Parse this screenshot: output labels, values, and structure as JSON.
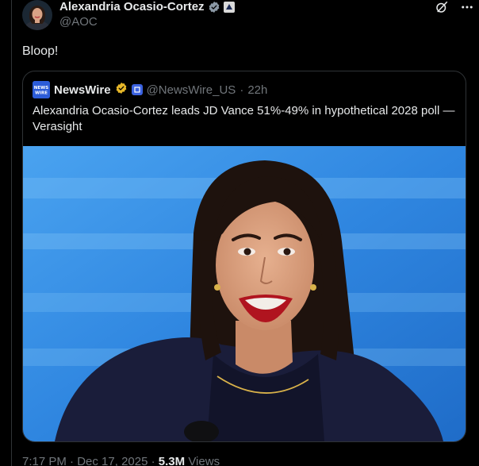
{
  "author": {
    "display_name": "Alexandria Ocasio-Cortez",
    "handle": "@AOC"
  },
  "post": {
    "text": "Bloop!"
  },
  "quoted": {
    "name": "NewsWire",
    "handle": "@NewsWire_US",
    "separator": "·",
    "time": "22h",
    "text": "Alexandria Ocasio-Cortez leads JD Vance 51%-49% in hypothetical 2028 poll — Verasight",
    "logo_text": "NEWS WIRE"
  },
  "meta": {
    "time": "7:17 PM",
    "dot1": "·",
    "date": "Dec 17, 2025",
    "dot2": "·",
    "views_count": "5.3M",
    "views_label": "Views"
  },
  "icons": [
    "verified-icon",
    "government-badge-icon",
    "grok-icon",
    "more-icon",
    "newswire-logo-icon",
    "org-verified-icon"
  ],
  "colors": {
    "background": "#000000",
    "text_primary": "#e7e9ea",
    "text_secondary": "#71767b",
    "border": "#2f3336",
    "verified_blue": "#1d9bf0",
    "gold_badge": "#e8b829",
    "image_sky": "#3a8fe0"
  }
}
